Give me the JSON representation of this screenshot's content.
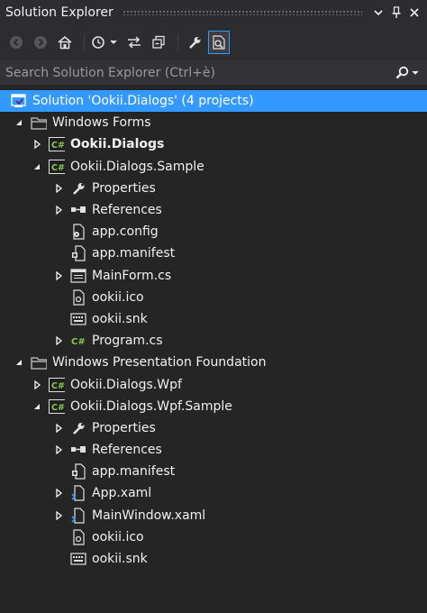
{
  "panel": {
    "title": "Solution Explorer",
    "pin_glyph": "❘",
    "dropdown_glyph": "▾",
    "close_glyph": "✕"
  },
  "search": {
    "placeholder": "Search Solution Explorer (Ctrl+è)"
  },
  "colors": {
    "background": "#252526",
    "selection": "#3399ff",
    "csharp_green": "#8cc54d",
    "folder": "#c8c8c8"
  },
  "toolbar": {
    "buttons": [
      "back-icon",
      "forward-icon",
      "home-icon",
      "pending-changes-icon",
      "sync-icon",
      "collapse-all-icon",
      "properties-icon",
      "preview-icon"
    ]
  },
  "tree": {
    "solution": "Solution 'Ookii.Dialogs' (4 projects)",
    "folder_wf": "Windows Forms",
    "proj_dialogs": "Ookii.Dialogs",
    "proj_sample": "Ookii.Dialogs.Sample",
    "sample_properties": "Properties",
    "sample_references": "References",
    "sample_app_config": "app.config",
    "sample_app_manifest": "app.manifest",
    "sample_mainform": "MainForm.cs",
    "sample_ico": "ookii.ico",
    "sample_snk": "ookii.snk",
    "sample_program": "Program.cs",
    "folder_wpf": "Windows Presentation Foundation",
    "proj_wpf": "Ookii.Dialogs.Wpf",
    "proj_wpf_sample": "Ookii.Dialogs.Wpf.Sample",
    "wpf_properties": "Properties",
    "wpf_references": "References",
    "wpf_app_manifest": "app.manifest",
    "wpf_app_xaml": "App.xaml",
    "wpf_mainwindow": "MainWindow.xaml",
    "wpf_ico": "ookii.ico",
    "wpf_snk": "ookii.snk"
  }
}
